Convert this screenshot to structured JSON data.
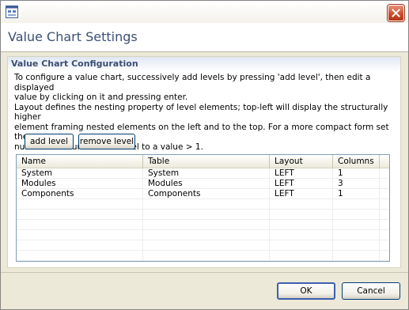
{
  "window": {
    "title": ""
  },
  "header": {
    "title": "Value Chart Settings"
  },
  "section": {
    "title": "Value Chart Configuration",
    "description_lines": [
      "To configure a value chart, successively add levels by pressing 'add level', then edit a displayed",
      "value by clicking on it and pressing enter.",
      "Layout defines the nesting property of level elements; top-left will display the structurally higher",
      "element framing nested elements on the left and to the top. For a more compact form set the",
      "number of columns for a level to a value > 1."
    ]
  },
  "toolbar": {
    "add_level_label": "add level",
    "remove_level_label": "remove level"
  },
  "table": {
    "columns": [
      "Name",
      "Table",
      "Layout",
      "Columns"
    ],
    "rows": [
      [
        "System",
        "System",
        "LEFT",
        "1"
      ],
      [
        "Modules",
        "Modules",
        "LEFT",
        "3"
      ],
      [
        "Components",
        "Components",
        "LEFT",
        "1"
      ],
      [
        "",
        "",
        "",
        ""
      ],
      [
        "",
        "",
        "",
        ""
      ],
      [
        "",
        "",
        "",
        ""
      ],
      [
        "",
        "",
        "",
        ""
      ],
      [
        "",
        "",
        "",
        ""
      ],
      [
        "",
        "",
        "",
        ""
      ]
    ]
  },
  "footer": {
    "ok_label": "OK",
    "cancel_label": "Cancel"
  },
  "colors": {
    "title_text": "#3A4F74",
    "close_button": "#C64A29",
    "dialog_bg": "#ECE9D8"
  },
  "icons": {
    "app": "app-window-icon",
    "close": "close-icon"
  }
}
